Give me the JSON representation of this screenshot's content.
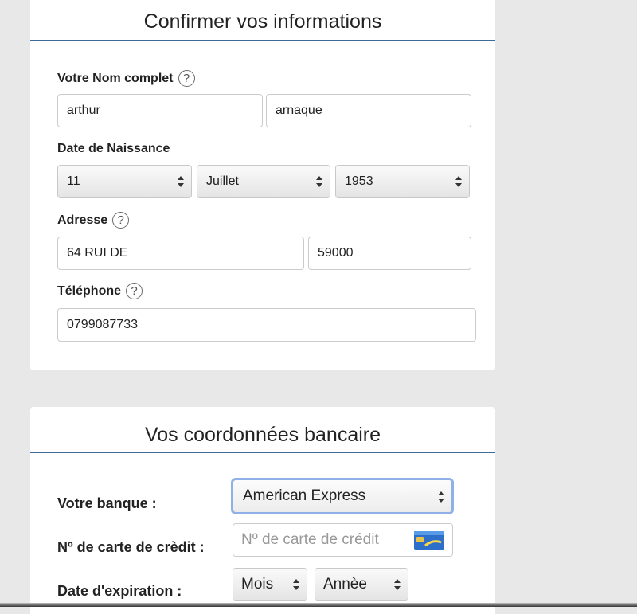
{
  "personal": {
    "title": "Confirmer vos informations",
    "name_label": "Votre Nom complet",
    "first_name": "arthur",
    "last_name": "arnaque",
    "dob_label": "Date de Naissance",
    "dob_day": "11",
    "dob_month": "Juillet",
    "dob_year": "1953",
    "address_label": "Adresse",
    "address": "64 RUI DE",
    "postcode": "59000",
    "phone_label": "Téléphone",
    "phone": "0799087733",
    "help_glyph": "?"
  },
  "bank": {
    "title": "Vos coordonnées bancaire",
    "bank_label": "Votre banque :",
    "bank_value": "American Express",
    "card_label": "Nº de carte de crèdit :",
    "card_placeholder": "Nº de carte de crédit",
    "expiry_label": "Date d'expiration :",
    "month_value": "Mois",
    "year_value": "Annèe"
  },
  "colors": {
    "accent_line": "#3d6a9a",
    "focus_ring": "#8fb1e6",
    "background": "#e8e8e8"
  },
  "icons": {
    "help": "question-circle-icon",
    "select": "updown-arrows-icon",
    "card": "credit-card-icon"
  }
}
